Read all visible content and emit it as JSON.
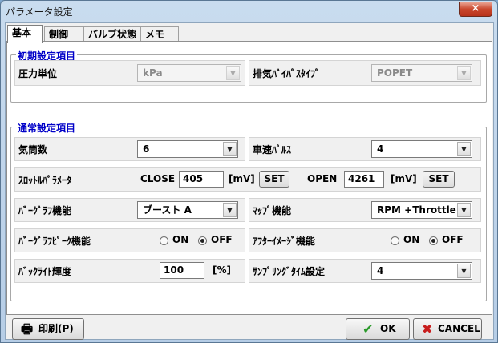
{
  "window": {
    "title": "パラメータ設定",
    "close_glyph": "×"
  },
  "tabs": [
    {
      "label": "基本"
    },
    {
      "label": "制御"
    },
    {
      "label": "バルブ状態"
    },
    {
      "label": "メモ"
    }
  ],
  "initial": {
    "title": "初期設定項目",
    "pressure_label": "圧力単位",
    "pressure_value": "kPa",
    "exhaust_label": "排気ﾊﾞｲﾊﾟｽﾀｲﾌﾟ",
    "exhaust_value": "POPET"
  },
  "normal": {
    "title": "通常設定項目",
    "cylinders_label": "気筒数",
    "cylinders_value": "6",
    "speed_pulse_label": "車速ﾊﾟﾙｽ",
    "speed_pulse_value": "4",
    "throttle_label": "ｽﾛｯﾄﾙﾊﾟﾗﾒｰﾀ",
    "close_label": "CLOSE",
    "close_value": "405",
    "open_label": "OPEN",
    "open_value": "4261",
    "unit_mv": "[mV]",
    "set_label": "SET",
    "bargraph_label": "ﾊﾞｰｸﾞﾗﾌ機能",
    "bargraph_value": "ブースト A",
    "map_label": "ﾏｯﾌﾟ機能",
    "map_value": "RPM +Throttle",
    "bargraph_peak_label": "ﾊﾞｰｸﾞﾗﾌﾋﾟｰｸ機能",
    "after_image_label": "ｱﾌﾀｰｲﾒｰｼﾞ機能",
    "on_label": "ON",
    "off_label": "OFF",
    "backlight_label": "ﾊﾞｯｸﾗｲﾄ輝度",
    "backlight_value": "100",
    "backlight_unit": "[%]",
    "sampling_label": "ｻﾝﾌﾟﾘﾝｸﾞﾀｲﾑ設定",
    "sampling_value": "4"
  },
  "footer": {
    "print_label": "印刷(P)",
    "ok_label": "OK",
    "cancel_label": "CANCEL"
  },
  "icons": {
    "dropdown": "▼",
    "printer": "🖶",
    "check": "✔",
    "cross": "✖"
  },
  "colors": {
    "group_title": "#0000c8",
    "ok_check": "#2a9a2a",
    "cancel_x": "#c81e1e"
  }
}
